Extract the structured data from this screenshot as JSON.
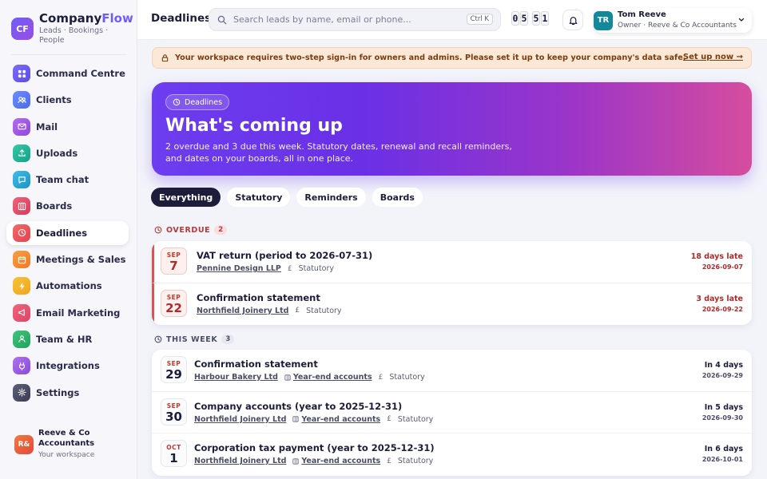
{
  "brand": {
    "logo": "CF",
    "name_main": "Company",
    "name_accent": "Flow",
    "tagline": "Leads · Bookings · People",
    "accent_color": "#6d5dfc"
  },
  "sidebar": {
    "items": [
      {
        "label": "Command Centre",
        "icon": "grid-icon",
        "color": "#6d5dfc"
      },
      {
        "label": "Clients",
        "icon": "users-icon",
        "color": "#5b7cf5"
      },
      {
        "label": "Mail",
        "icon": "mail-icon",
        "color": "#a45ce6"
      },
      {
        "label": "Uploads",
        "icon": "upload-icon",
        "color": "#1fb89a"
      },
      {
        "label": "Team chat",
        "icon": "chat-icon",
        "color": "#2aa6d6"
      },
      {
        "label": "Boards",
        "icon": "boards-icon",
        "color": "#e8506a"
      },
      {
        "label": "Deadlines",
        "icon": "clock-icon",
        "color": "#e8505b",
        "active": true
      },
      {
        "label": "Meetings & Sales",
        "icon": "calendar-icon",
        "color": "#f28a2e"
      },
      {
        "label": "Automations",
        "icon": "bolt-icon",
        "color": "#f2b324"
      },
      {
        "label": "Email Marketing",
        "icon": "megaphone-icon",
        "color": "#e8506a"
      },
      {
        "label": "Team & HR",
        "icon": "team-icon",
        "color": "#2fb36c"
      },
      {
        "label": "Integrations",
        "icon": "plug-icon",
        "color": "#9b5de5"
      },
      {
        "label": "Settings",
        "icon": "gear-icon",
        "color": "#4a4d66"
      }
    ],
    "workspace": {
      "avatar": "R&",
      "name": "Reeve & Co Accountants",
      "sub": "Your workspace"
    }
  },
  "header": {
    "title": "Deadlines",
    "search_placeholder": "Search leads by name, email or phone...",
    "shortcut": "Ctrl K",
    "clock": [
      "0",
      "5",
      "5",
      "1"
    ],
    "user": {
      "avatar": "TR",
      "name": "Tom Reeve",
      "role": "Owner · Reeve & Co Accountants"
    }
  },
  "banner": {
    "text": "Your workspace requires two-step sign-in for owners and admins. Please set it up to keep your company's data safe.",
    "link": "Set up now →"
  },
  "hero": {
    "badge": "Deadlines",
    "title": "What's coming up",
    "subtitle": "2 overdue and 3 due this week. Statutory dates, renewal and recall reminders, and dates on your boards, all in one place."
  },
  "tabs": [
    "Everything",
    "Statutory",
    "Reminders",
    "Boards"
  ],
  "sections": {
    "overdue": {
      "label": "OVERDUE",
      "count": "2",
      "rows": [
        {
          "month": "SEP",
          "day": "7",
          "title": "VAT return (period to 2026-07-31)",
          "client": "Pennine Design LLP",
          "board": "",
          "pound": "£",
          "category": "Statutory",
          "status": "18 days late",
          "date": "2026-09-07"
        },
        {
          "month": "SEP",
          "day": "22",
          "title": "Confirmation statement",
          "client": "Northfield Joinery Ltd",
          "board": "",
          "pound": "£",
          "category": "Statutory",
          "status": "3 days late",
          "date": "2026-09-22"
        }
      ]
    },
    "week": {
      "label": "THIS WEEK",
      "count": "3",
      "rows": [
        {
          "month": "SEP",
          "day": "29",
          "title": "Confirmation statement",
          "client": "Harbour Bakery Ltd",
          "board": "Year-end accounts",
          "pound": "£",
          "category": "Statutory",
          "status": "In 4 days",
          "date": "2026-09-29"
        },
        {
          "month": "SEP",
          "day": "30",
          "title": "Company accounts (year to 2025-12-31)",
          "client": "Northfield Joinery Ltd",
          "board": "Year-end accounts",
          "pound": "£",
          "category": "Statutory",
          "status": "In 5 days",
          "date": "2026-09-30"
        },
        {
          "month": "OCT",
          "day": "1",
          "title": "Corporation tax payment (year to 2025-12-31)",
          "client": "Northfield Joinery Ltd",
          "board": "Year-end accounts",
          "pound": "£",
          "category": "Statutory",
          "status": "In 6 days",
          "date": "2026-10-01"
        }
      ]
    }
  }
}
